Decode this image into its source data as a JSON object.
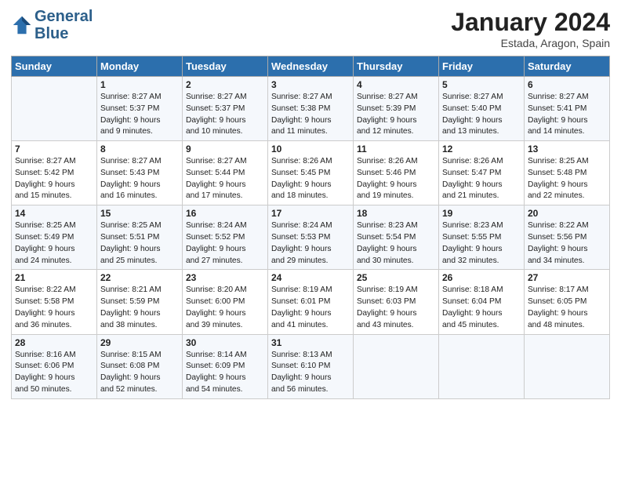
{
  "header": {
    "logo_line1": "General",
    "logo_line2": "Blue",
    "month": "January 2024",
    "location": "Estada, Aragon, Spain"
  },
  "days_of_week": [
    "Sunday",
    "Monday",
    "Tuesday",
    "Wednesday",
    "Thursday",
    "Friday",
    "Saturday"
  ],
  "weeks": [
    [
      {
        "day": "",
        "info": ""
      },
      {
        "day": "1",
        "info": "Sunrise: 8:27 AM\nSunset: 5:37 PM\nDaylight: 9 hours\nand 9 minutes."
      },
      {
        "day": "2",
        "info": "Sunrise: 8:27 AM\nSunset: 5:37 PM\nDaylight: 9 hours\nand 10 minutes."
      },
      {
        "day": "3",
        "info": "Sunrise: 8:27 AM\nSunset: 5:38 PM\nDaylight: 9 hours\nand 11 minutes."
      },
      {
        "day": "4",
        "info": "Sunrise: 8:27 AM\nSunset: 5:39 PM\nDaylight: 9 hours\nand 12 minutes."
      },
      {
        "day": "5",
        "info": "Sunrise: 8:27 AM\nSunset: 5:40 PM\nDaylight: 9 hours\nand 13 minutes."
      },
      {
        "day": "6",
        "info": "Sunrise: 8:27 AM\nSunset: 5:41 PM\nDaylight: 9 hours\nand 14 minutes."
      }
    ],
    [
      {
        "day": "7",
        "info": "Sunrise: 8:27 AM\nSunset: 5:42 PM\nDaylight: 9 hours\nand 15 minutes."
      },
      {
        "day": "8",
        "info": "Sunrise: 8:27 AM\nSunset: 5:43 PM\nDaylight: 9 hours\nand 16 minutes."
      },
      {
        "day": "9",
        "info": "Sunrise: 8:27 AM\nSunset: 5:44 PM\nDaylight: 9 hours\nand 17 minutes."
      },
      {
        "day": "10",
        "info": "Sunrise: 8:26 AM\nSunset: 5:45 PM\nDaylight: 9 hours\nand 18 minutes."
      },
      {
        "day": "11",
        "info": "Sunrise: 8:26 AM\nSunset: 5:46 PM\nDaylight: 9 hours\nand 19 minutes."
      },
      {
        "day": "12",
        "info": "Sunrise: 8:26 AM\nSunset: 5:47 PM\nDaylight: 9 hours\nand 21 minutes."
      },
      {
        "day": "13",
        "info": "Sunrise: 8:25 AM\nSunset: 5:48 PM\nDaylight: 9 hours\nand 22 minutes."
      }
    ],
    [
      {
        "day": "14",
        "info": "Sunrise: 8:25 AM\nSunset: 5:49 PM\nDaylight: 9 hours\nand 24 minutes."
      },
      {
        "day": "15",
        "info": "Sunrise: 8:25 AM\nSunset: 5:51 PM\nDaylight: 9 hours\nand 25 minutes."
      },
      {
        "day": "16",
        "info": "Sunrise: 8:24 AM\nSunset: 5:52 PM\nDaylight: 9 hours\nand 27 minutes."
      },
      {
        "day": "17",
        "info": "Sunrise: 8:24 AM\nSunset: 5:53 PM\nDaylight: 9 hours\nand 29 minutes."
      },
      {
        "day": "18",
        "info": "Sunrise: 8:23 AM\nSunset: 5:54 PM\nDaylight: 9 hours\nand 30 minutes."
      },
      {
        "day": "19",
        "info": "Sunrise: 8:23 AM\nSunset: 5:55 PM\nDaylight: 9 hours\nand 32 minutes."
      },
      {
        "day": "20",
        "info": "Sunrise: 8:22 AM\nSunset: 5:56 PM\nDaylight: 9 hours\nand 34 minutes."
      }
    ],
    [
      {
        "day": "21",
        "info": "Sunrise: 8:22 AM\nSunset: 5:58 PM\nDaylight: 9 hours\nand 36 minutes."
      },
      {
        "day": "22",
        "info": "Sunrise: 8:21 AM\nSunset: 5:59 PM\nDaylight: 9 hours\nand 38 minutes."
      },
      {
        "day": "23",
        "info": "Sunrise: 8:20 AM\nSunset: 6:00 PM\nDaylight: 9 hours\nand 39 minutes."
      },
      {
        "day": "24",
        "info": "Sunrise: 8:19 AM\nSunset: 6:01 PM\nDaylight: 9 hours\nand 41 minutes."
      },
      {
        "day": "25",
        "info": "Sunrise: 8:19 AM\nSunset: 6:03 PM\nDaylight: 9 hours\nand 43 minutes."
      },
      {
        "day": "26",
        "info": "Sunrise: 8:18 AM\nSunset: 6:04 PM\nDaylight: 9 hours\nand 45 minutes."
      },
      {
        "day": "27",
        "info": "Sunrise: 8:17 AM\nSunset: 6:05 PM\nDaylight: 9 hours\nand 48 minutes."
      }
    ],
    [
      {
        "day": "28",
        "info": "Sunrise: 8:16 AM\nSunset: 6:06 PM\nDaylight: 9 hours\nand 50 minutes."
      },
      {
        "day": "29",
        "info": "Sunrise: 8:15 AM\nSunset: 6:08 PM\nDaylight: 9 hours\nand 52 minutes."
      },
      {
        "day": "30",
        "info": "Sunrise: 8:14 AM\nSunset: 6:09 PM\nDaylight: 9 hours\nand 54 minutes."
      },
      {
        "day": "31",
        "info": "Sunrise: 8:13 AM\nSunset: 6:10 PM\nDaylight: 9 hours\nand 56 minutes."
      },
      {
        "day": "",
        "info": ""
      },
      {
        "day": "",
        "info": ""
      },
      {
        "day": "",
        "info": ""
      }
    ]
  ]
}
